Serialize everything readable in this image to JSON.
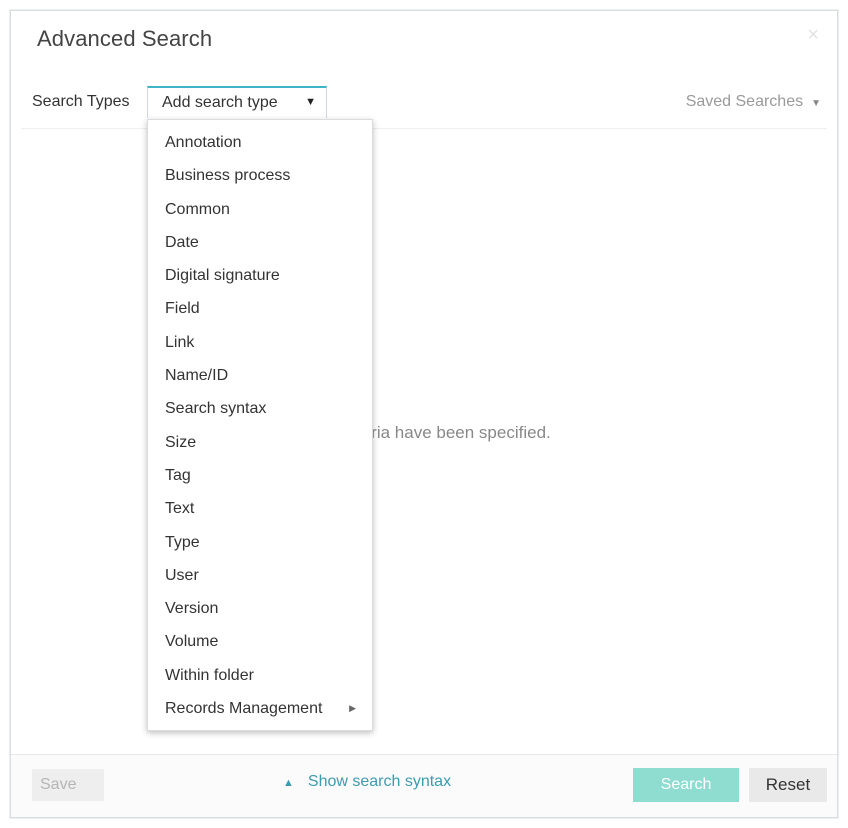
{
  "dialog": {
    "title": "Advanced Search",
    "close_icon": "×"
  },
  "toolbar": {
    "search_types_label": "Search Types",
    "add_type_label": "Add search type",
    "add_type_caret": "▼",
    "saved_searches_label": "Saved Searches",
    "saved_caret": "▼"
  },
  "main": {
    "empty_message_visible": "teria have been specified."
  },
  "dropdown": {
    "items": [
      {
        "label": "Annotation"
      },
      {
        "label": "Business process"
      },
      {
        "label": "Common"
      },
      {
        "label": "Date"
      },
      {
        "label": "Digital signature"
      },
      {
        "label": "Field"
      },
      {
        "label": "Link"
      },
      {
        "label": "Name/ID"
      },
      {
        "label": "Search syntax"
      },
      {
        "label": "Size"
      },
      {
        "label": "Tag"
      },
      {
        "label": "Text"
      },
      {
        "label": "Type"
      },
      {
        "label": "User"
      },
      {
        "label": "Version"
      },
      {
        "label": "Volume"
      },
      {
        "label": "Within folder"
      },
      {
        "label": "Records Management",
        "submenu_arrow": "▶"
      }
    ]
  },
  "footer": {
    "save_label": "Save",
    "show_syntax_label": "Show search syntax",
    "show_syntax_chevron": "▲",
    "search_label": "Search",
    "reset_label": "Reset"
  },
  "colors": {
    "accent": "#3fb4c8",
    "search_button": "#8fdcd0",
    "link": "#3d9bb0"
  }
}
